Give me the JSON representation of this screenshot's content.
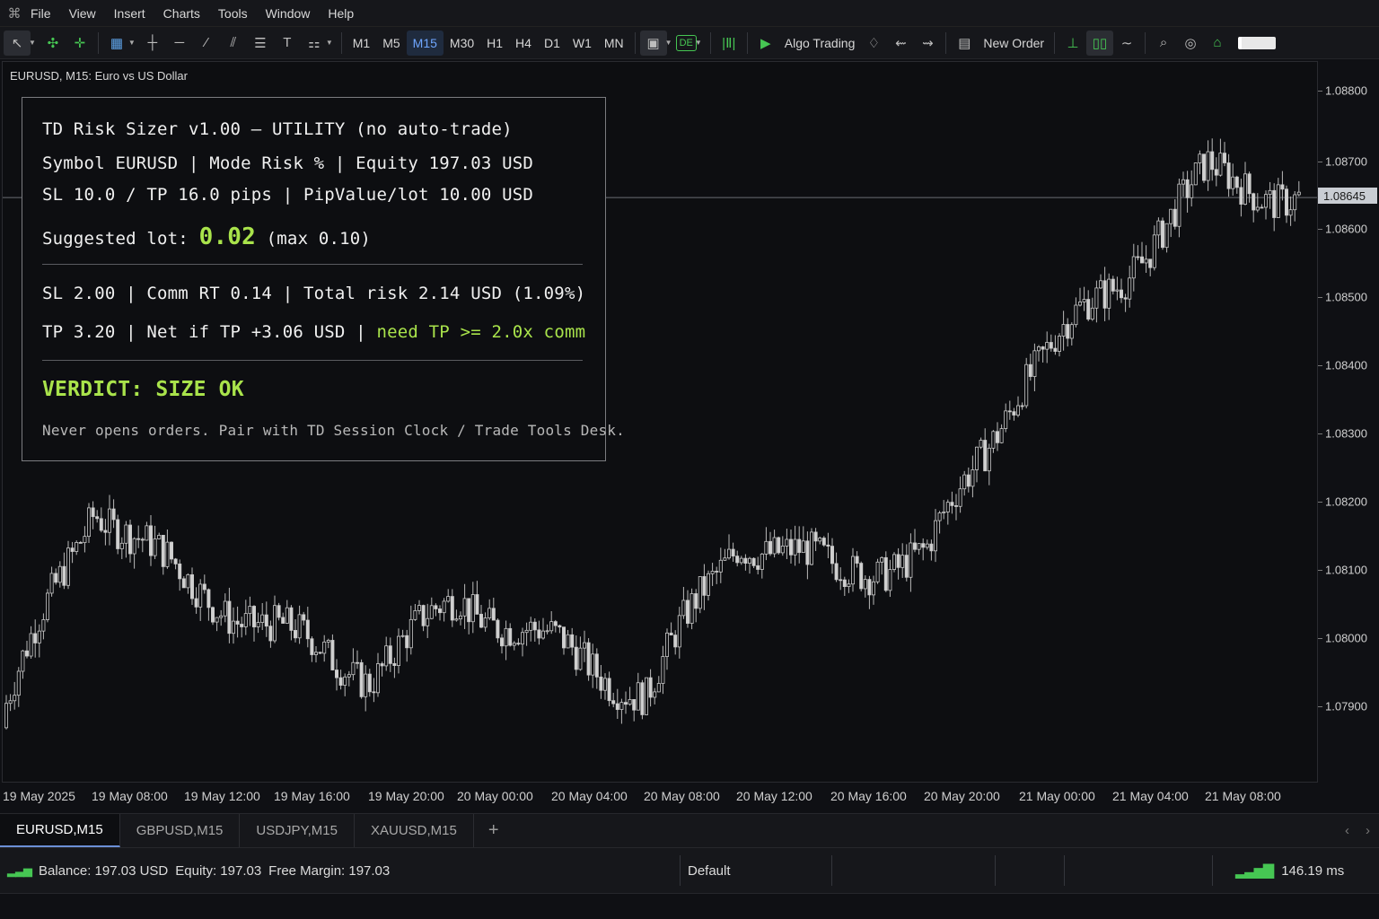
{
  "menu": [
    "File",
    "View",
    "Insert",
    "Charts",
    "Tools",
    "Window",
    "Help"
  ],
  "toolbar": {
    "timeframes": [
      "M1",
      "M5",
      "M15",
      "M30",
      "H1",
      "H4",
      "D1",
      "W1",
      "MN"
    ],
    "active_timeframe": "M15",
    "algo_trading_label": "Algo Trading",
    "new_order_label": "New Order",
    "de_badge": "DE"
  },
  "chart": {
    "title": "EURUSD, M15:  Euro vs US Dollar",
    "price_labels": [
      "1.08800",
      "1.08700",
      "1.08600",
      "1.08500",
      "1.08400",
      "1.08300",
      "1.08200",
      "1.08100",
      "1.08000",
      "1.07900"
    ],
    "current_price": "1.08645",
    "time_labels": [
      "19 May 2025",
      "19 May 08:00",
      "19 May 12:00",
      "19 May 16:00",
      "19 May 20:00",
      "20 May 00:00",
      "20 May 04:00",
      "20 May 08:00",
      "20 May 12:00",
      "20 May 16:00",
      "20 May 20:00",
      "21 May 00:00",
      "21 May 04:00",
      "21 May 08:00"
    ]
  },
  "chart_data": {
    "type": "candlestick",
    "symbol": "EURUSD",
    "timeframe": "M15",
    "ylim": [
      1.0785,
      1.0885
    ],
    "current_price": 1.08645,
    "x": [
      "19 May 2025",
      "19 May 08:00",
      "19 May 12:00",
      "19 May 16:00",
      "19 May 20:00",
      "20 May 00:00",
      "20 May 04:00",
      "20 May 08:00",
      "20 May 12:00",
      "20 May 16:00",
      "20 May 20:00",
      "21 May 00:00",
      "21 May 04:00",
      "21 May 08:00"
    ],
    "close": [
      1.079,
      1.082,
      1.0808,
      1.0801,
      1.0795,
      1.0806,
      1.0799,
      1.0792,
      1.0815,
      1.081,
      1.0812,
      1.0838,
      1.0852,
      1.0868
    ],
    "grid": false
  },
  "panel": {
    "title": "TD Risk Sizer v1.00 — UTILITY (no auto-trade)",
    "line1": "Symbol EURUSD | Mode Risk % | Equity 197.03 USD",
    "line2": "SL 10.0 / TP 16.0 pips | PipValue/lot 10.00 USD",
    "lot_prefix": "Suggested lot: ",
    "lot_value": "0.02",
    "lot_suffix": " (max 0.10)",
    "risk_line": "SL 2.00 | Comm RT 0.14 | Total risk 2.14 USD (1.09%)",
    "tp_line": "TP 3.20 | Net if TP +3.06 USD | ",
    "tp_hint": "need TP >= 2.0x comm",
    "verdict": "VERDICT: SIZE OK",
    "footer": "Never opens orders. Pair with TD Session Clock / Trade Tools Desk."
  },
  "tabs": [
    "EURUSD,M15",
    "GBPUSD,M15",
    "USDJPY,M15",
    "XAUUSD,M15"
  ],
  "active_tab": "EURUSD,M15",
  "status": {
    "balance": "Balance: 197.03 USD",
    "equity": "Equity: 197.03",
    "free_margin": "Free Margin: 197.03",
    "profile": "Default",
    "ping": "146.19 ms"
  },
  "colors": {
    "accent_green": "#a9e34b",
    "active_blue": "#6fa6ff",
    "candle": "#c8c8c8"
  }
}
